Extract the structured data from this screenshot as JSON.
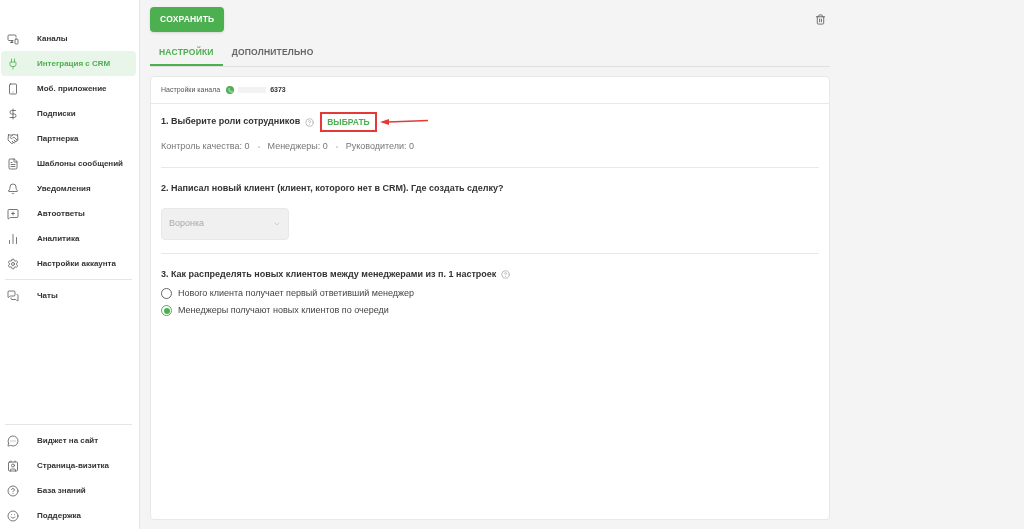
{
  "sidebar": {
    "items": [
      {
        "label": "Каналы",
        "selected": false
      },
      {
        "label": "Интеграция с CRM",
        "selected": true
      },
      {
        "label": "Моб. приложение",
        "selected": false
      },
      {
        "label": "Подписки",
        "selected": false
      },
      {
        "label": "Партнерка",
        "selected": false
      },
      {
        "label": "Шаблоны сообщений",
        "selected": false
      },
      {
        "label": "Уведомления",
        "selected": false
      },
      {
        "label": "Автоответы",
        "selected": false
      },
      {
        "label": "Аналитика",
        "selected": false
      },
      {
        "label": "Настройки аккаунта",
        "selected": false
      }
    ],
    "extra_items": [
      {
        "label": "Чаты",
        "selected": false
      }
    ],
    "bottom_items": [
      {
        "label": "Виджет на сайт"
      },
      {
        "label": "Страница-визитка"
      },
      {
        "label": "База знаний"
      },
      {
        "label": "Поддержка"
      }
    ]
  },
  "save_button": "СОХРАНИТЬ",
  "tabs": [
    {
      "label": "НАСТРОЙКИ",
      "selected": true
    },
    {
      "label": "ДОПОЛНИТЕЛЬНО",
      "selected": false
    }
  ],
  "card": {
    "channel_label": "Настройки канала",
    "channel_number": "6373",
    "section_1": {
      "title": "1. Выберите роли сотрудников",
      "choose_button": "ВЫБРАТЬ",
      "roles": [
        "Контроль качества: 0",
        "Менеджеры: 0",
        "Руководители: 0"
      ]
    },
    "section_2": {
      "title": "2. Написал новый клиент (клиент, которого нет в CRM). Где создать сделку?",
      "select": {
        "placeholder": "Воронка",
        "disabled": true
      }
    },
    "section_3": {
      "title": "3. Как распределять новых клиентов между менеджерами из п. 1 настроек",
      "options": [
        {
          "label": "Нового клиента получает первый ответивший менеджер",
          "selected": false
        },
        {
          "label": "Менеджеры получают новых клиентов по очереди",
          "selected": true
        }
      ]
    }
  }
}
